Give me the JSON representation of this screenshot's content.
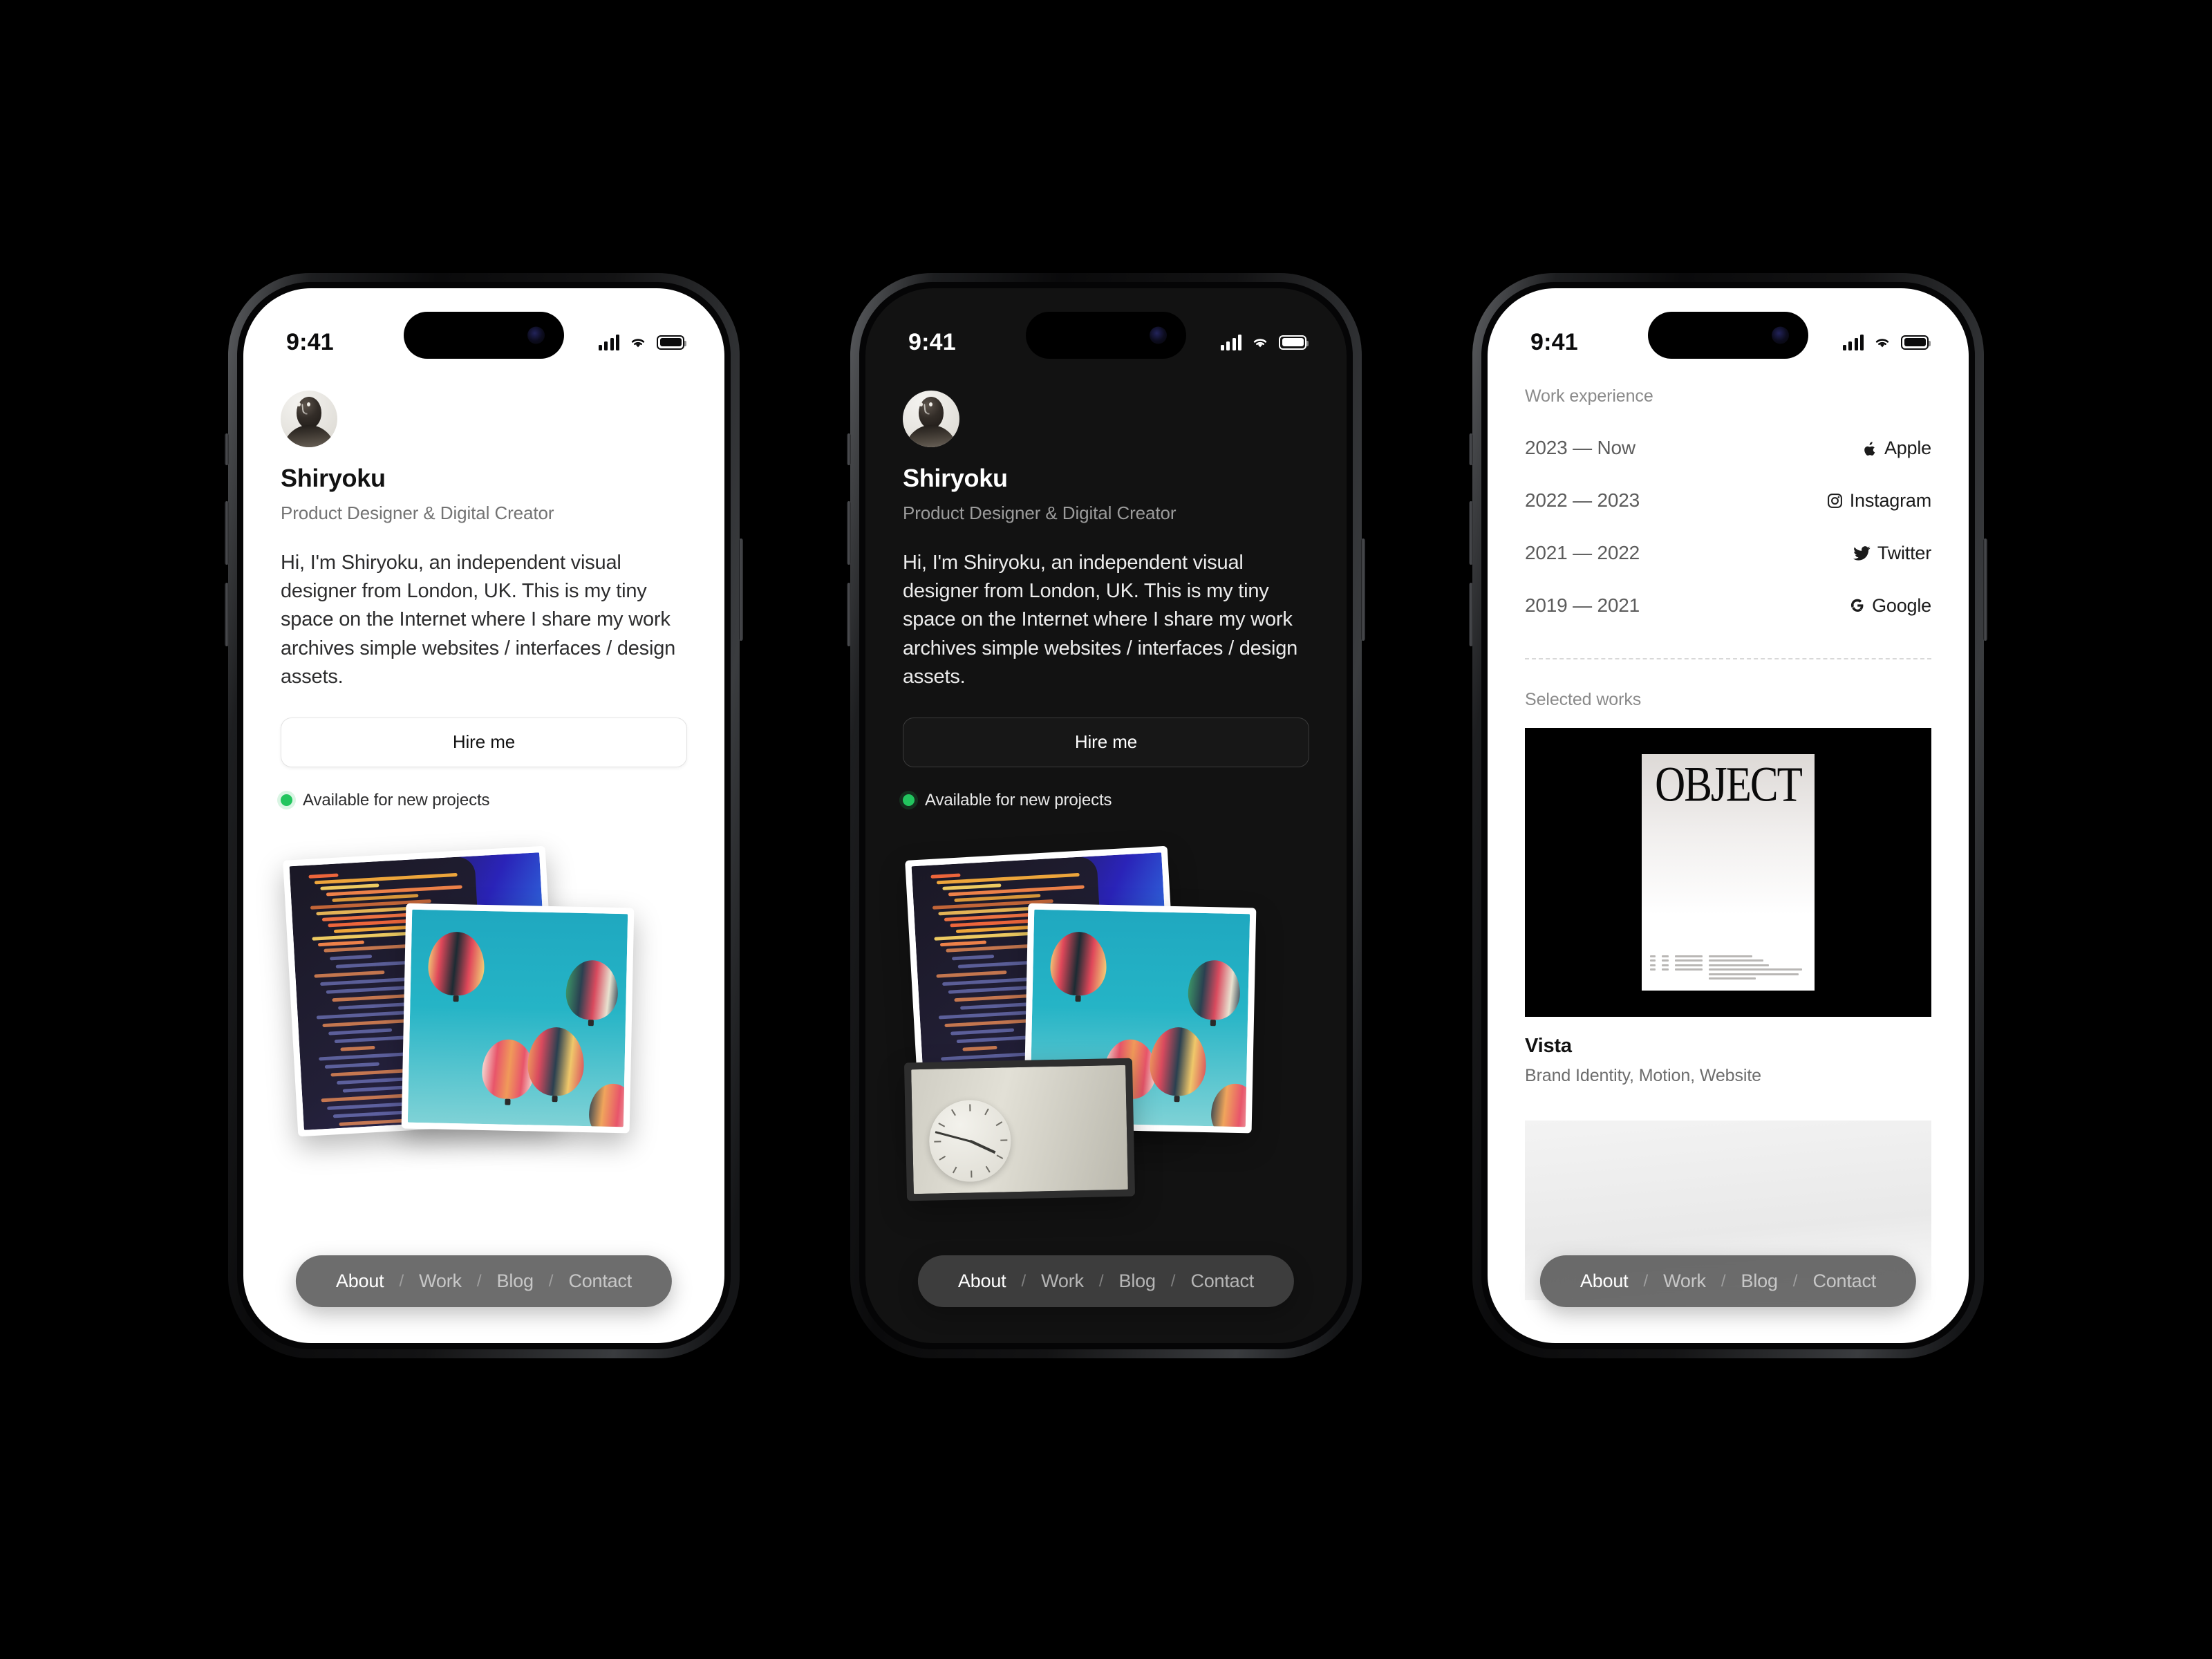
{
  "status_bar": {
    "time": "9:41",
    "signal_icon": "cellular-bars-icon",
    "wifi_icon": "wifi-icon",
    "battery_icon": "battery-icon"
  },
  "profile": {
    "avatar_alt": "avatar",
    "name": "Shiryoku",
    "role": "Product Designer & Digital Creator",
    "bio": "Hi, I'm Shiryoku, an independent visual designer from London, UK. This is my tiny space on the Internet where I share my work archives simple websites / interfaces / design assets.",
    "hire_label": "Hire me",
    "availability": "Available for new projects",
    "availability_color": "#22c55e"
  },
  "work_experience": {
    "label": "Work experience",
    "rows": [
      {
        "years": "2023 — Now",
        "company": "Apple",
        "icon": "apple-logo-icon"
      },
      {
        "years": "2022 — 2023",
        "company": "Instagram",
        "icon": "instagram-logo-icon"
      },
      {
        "years": "2021 — 2022",
        "company": "Twitter",
        "icon": "twitter-bird-icon"
      },
      {
        "years": "2019 — 2021",
        "company": "Google",
        "icon": "google-g-icon"
      }
    ]
  },
  "selected_works": {
    "label": "Selected works",
    "items": [
      {
        "title": "Vista",
        "tags": "Brand Identity, Motion, Website",
        "poster_word": "OBJECT"
      }
    ]
  },
  "nav": {
    "items": [
      {
        "label": "About",
        "active": true
      },
      {
        "label": "Work",
        "active": false
      },
      {
        "label": "Blog",
        "active": false
      },
      {
        "label": "Contact",
        "active": false
      }
    ],
    "separator": "/"
  },
  "screens": [
    {
      "id": "screen-light-about",
      "theme": "light"
    },
    {
      "id": "screen-dark-about",
      "theme": "dark"
    },
    {
      "id": "screen-light-work",
      "theme": "light"
    }
  ],
  "colors": {
    "background": "#000000",
    "light_bg": "#ffffff",
    "dark_bg": "#121212",
    "nav_pill": "#484848"
  }
}
